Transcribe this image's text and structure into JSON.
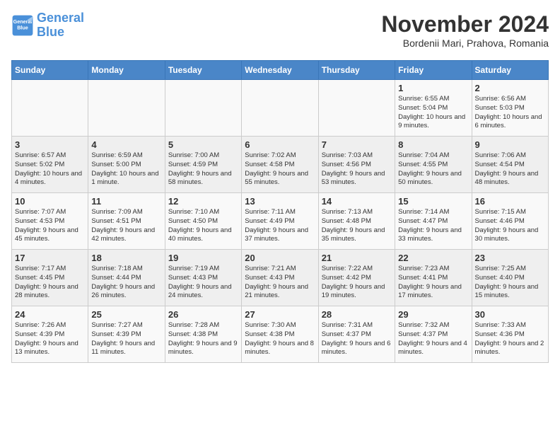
{
  "logo": {
    "line1": "General",
    "line2": "Blue"
  },
  "title": "November 2024",
  "subtitle": "Bordenii Mari, Prahova, Romania",
  "weekdays": [
    "Sunday",
    "Monday",
    "Tuesday",
    "Wednesday",
    "Thursday",
    "Friday",
    "Saturday"
  ],
  "weeks": [
    [
      {
        "day": "",
        "info": ""
      },
      {
        "day": "",
        "info": ""
      },
      {
        "day": "",
        "info": ""
      },
      {
        "day": "",
        "info": ""
      },
      {
        "day": "",
        "info": ""
      },
      {
        "day": "1",
        "info": "Sunrise: 6:55 AM\nSunset: 5:04 PM\nDaylight: 10 hours\nand 9 minutes."
      },
      {
        "day": "2",
        "info": "Sunrise: 6:56 AM\nSunset: 5:03 PM\nDaylight: 10 hours\nand 6 minutes."
      }
    ],
    [
      {
        "day": "3",
        "info": "Sunrise: 6:57 AM\nSunset: 5:02 PM\nDaylight: 10 hours\nand 4 minutes."
      },
      {
        "day": "4",
        "info": "Sunrise: 6:59 AM\nSunset: 5:00 PM\nDaylight: 10 hours\nand 1 minute."
      },
      {
        "day": "5",
        "info": "Sunrise: 7:00 AM\nSunset: 4:59 PM\nDaylight: 9 hours\nand 58 minutes."
      },
      {
        "day": "6",
        "info": "Sunrise: 7:02 AM\nSunset: 4:58 PM\nDaylight: 9 hours\nand 55 minutes."
      },
      {
        "day": "7",
        "info": "Sunrise: 7:03 AM\nSunset: 4:56 PM\nDaylight: 9 hours\nand 53 minutes."
      },
      {
        "day": "8",
        "info": "Sunrise: 7:04 AM\nSunset: 4:55 PM\nDaylight: 9 hours\nand 50 minutes."
      },
      {
        "day": "9",
        "info": "Sunrise: 7:06 AM\nSunset: 4:54 PM\nDaylight: 9 hours\nand 48 minutes."
      }
    ],
    [
      {
        "day": "10",
        "info": "Sunrise: 7:07 AM\nSunset: 4:53 PM\nDaylight: 9 hours\nand 45 minutes."
      },
      {
        "day": "11",
        "info": "Sunrise: 7:09 AM\nSunset: 4:51 PM\nDaylight: 9 hours\nand 42 minutes."
      },
      {
        "day": "12",
        "info": "Sunrise: 7:10 AM\nSunset: 4:50 PM\nDaylight: 9 hours\nand 40 minutes."
      },
      {
        "day": "13",
        "info": "Sunrise: 7:11 AM\nSunset: 4:49 PM\nDaylight: 9 hours\nand 37 minutes."
      },
      {
        "day": "14",
        "info": "Sunrise: 7:13 AM\nSunset: 4:48 PM\nDaylight: 9 hours\nand 35 minutes."
      },
      {
        "day": "15",
        "info": "Sunrise: 7:14 AM\nSunset: 4:47 PM\nDaylight: 9 hours\nand 33 minutes."
      },
      {
        "day": "16",
        "info": "Sunrise: 7:15 AM\nSunset: 4:46 PM\nDaylight: 9 hours\nand 30 minutes."
      }
    ],
    [
      {
        "day": "17",
        "info": "Sunrise: 7:17 AM\nSunset: 4:45 PM\nDaylight: 9 hours\nand 28 minutes."
      },
      {
        "day": "18",
        "info": "Sunrise: 7:18 AM\nSunset: 4:44 PM\nDaylight: 9 hours\nand 26 minutes."
      },
      {
        "day": "19",
        "info": "Sunrise: 7:19 AM\nSunset: 4:43 PM\nDaylight: 9 hours\nand 24 minutes."
      },
      {
        "day": "20",
        "info": "Sunrise: 7:21 AM\nSunset: 4:43 PM\nDaylight: 9 hours\nand 21 minutes."
      },
      {
        "day": "21",
        "info": "Sunrise: 7:22 AM\nSunset: 4:42 PM\nDaylight: 9 hours\nand 19 minutes."
      },
      {
        "day": "22",
        "info": "Sunrise: 7:23 AM\nSunset: 4:41 PM\nDaylight: 9 hours\nand 17 minutes."
      },
      {
        "day": "23",
        "info": "Sunrise: 7:25 AM\nSunset: 4:40 PM\nDaylight: 9 hours\nand 15 minutes."
      }
    ],
    [
      {
        "day": "24",
        "info": "Sunrise: 7:26 AM\nSunset: 4:39 PM\nDaylight: 9 hours\nand 13 minutes."
      },
      {
        "day": "25",
        "info": "Sunrise: 7:27 AM\nSunset: 4:39 PM\nDaylight: 9 hours\nand 11 minutes."
      },
      {
        "day": "26",
        "info": "Sunrise: 7:28 AM\nSunset: 4:38 PM\nDaylight: 9 hours\nand 9 minutes."
      },
      {
        "day": "27",
        "info": "Sunrise: 7:30 AM\nSunset: 4:38 PM\nDaylight: 9 hours\nand 8 minutes."
      },
      {
        "day": "28",
        "info": "Sunrise: 7:31 AM\nSunset: 4:37 PM\nDaylight: 9 hours\nand 6 minutes."
      },
      {
        "day": "29",
        "info": "Sunrise: 7:32 AM\nSunset: 4:37 PM\nDaylight: 9 hours\nand 4 minutes."
      },
      {
        "day": "30",
        "info": "Sunrise: 7:33 AM\nSunset: 4:36 PM\nDaylight: 9 hours\nand 2 minutes."
      }
    ]
  ]
}
